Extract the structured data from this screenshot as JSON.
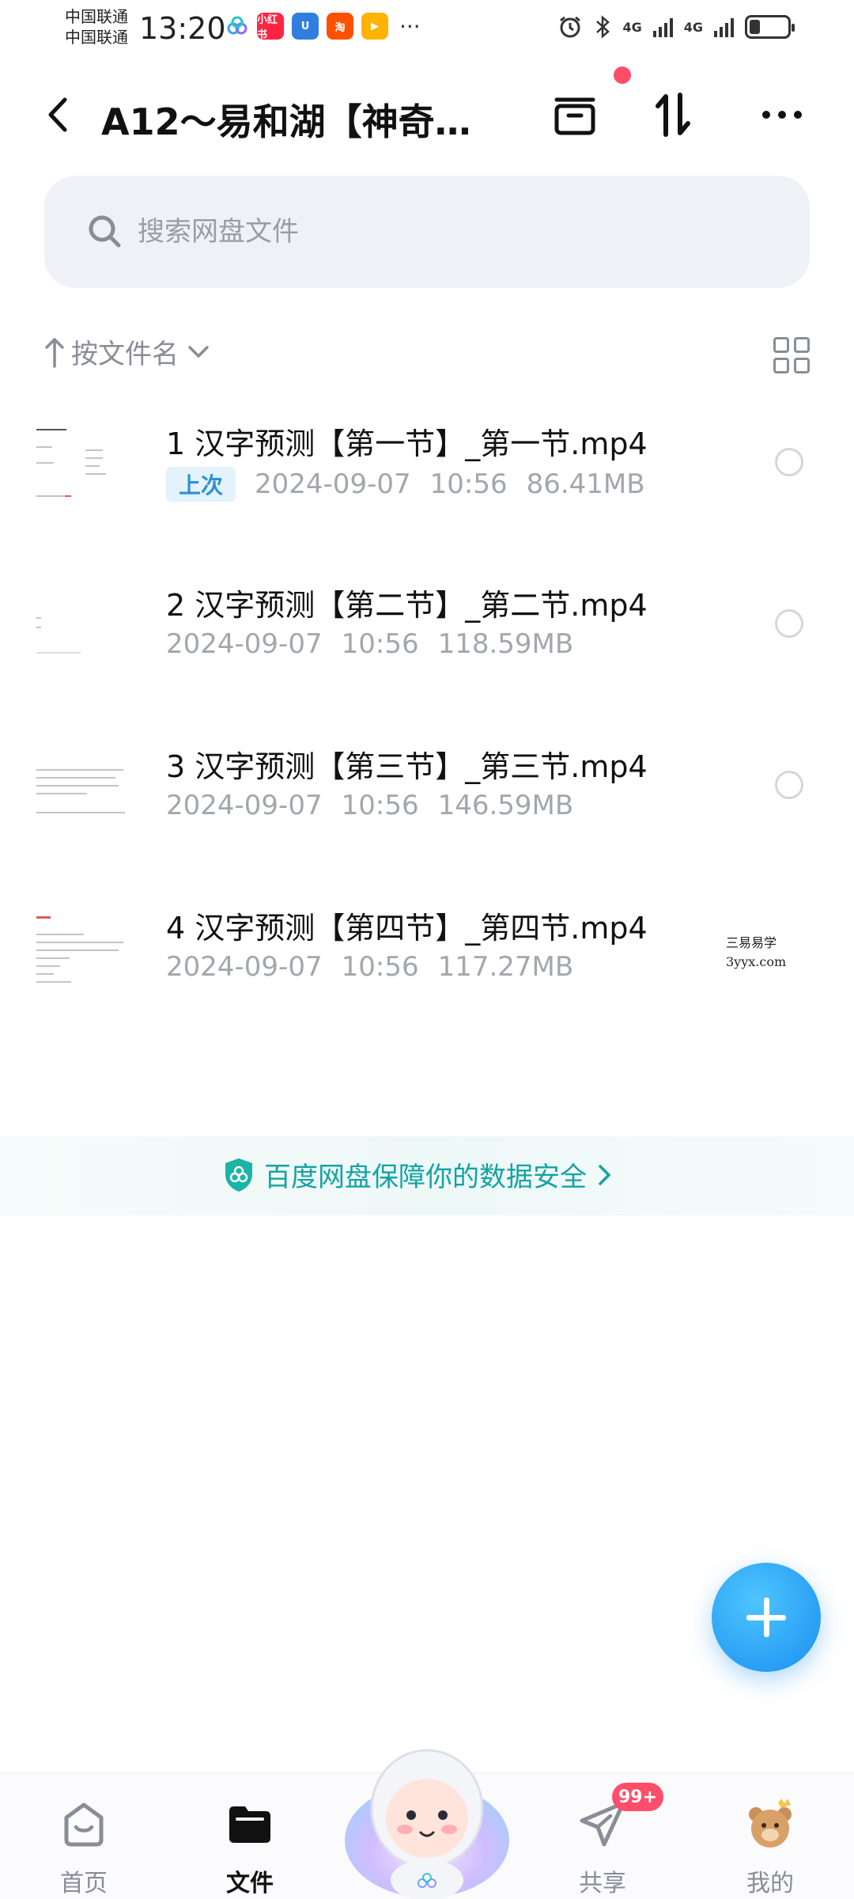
{
  "status_bar": {
    "carrier_1": "中国联通",
    "carrier_2": "中国联通",
    "time": "13:20",
    "apps": [
      {
        "label": "小红书",
        "color": "#ff2442"
      },
      {
        "label": "U",
        "color": "#2f7fe0"
      },
      {
        "label": "淘",
        "color": "#ff5000"
      },
      {
        "label": "▶",
        "color": "#ffb300"
      }
    ],
    "more": "···",
    "network_1": "4G",
    "network_2": "4G",
    "battery_level": 0.25
  },
  "header": {
    "title": "A12～易和湖【神奇…",
    "has_notification": true
  },
  "search": {
    "placeholder": "搜索网盘文件"
  },
  "sort": {
    "label": "按文件名"
  },
  "files": [
    {
      "name": "1 汉字预测【第一节】_第一节.mp4",
      "tag": "上次",
      "date": "2024-09-07",
      "time": "10:56",
      "size": "86.41MB"
    },
    {
      "name": "2 汉字预测【第二节】_第二节.mp4",
      "tag": "",
      "date": "2024-09-07",
      "time": "10:56",
      "size": "118.59MB"
    },
    {
      "name": "3 汉字预测【第三节】_第三节.mp4",
      "tag": "",
      "date": "2024-09-07",
      "time": "10:56",
      "size": "146.59MB"
    },
    {
      "name": "4 汉字预测【第四节】_第四节.mp4",
      "tag": "",
      "date": "2024-09-07",
      "time": "10:56",
      "size": "117.27MB"
    }
  ],
  "watermark": {
    "line1": "三易易学",
    "line2": "3yyx.com"
  },
  "security": {
    "text": "百度网盘保障你的数据安全"
  },
  "bottom_nav": {
    "items": [
      {
        "label": "首页",
        "icon": "home-icon"
      },
      {
        "label": "文件",
        "icon": "folder-icon",
        "active": true
      },
      {
        "label": "共享",
        "icon": "paper-plane-icon",
        "badge": "99+"
      },
      {
        "label": "我的",
        "icon": "bear-avatar-icon"
      }
    ]
  },
  "colors": {
    "accent": "#1a8ff0",
    "badge": "#ff4d6a",
    "security_text": "#14a3a4",
    "tag_text": "#2b90d9"
  }
}
